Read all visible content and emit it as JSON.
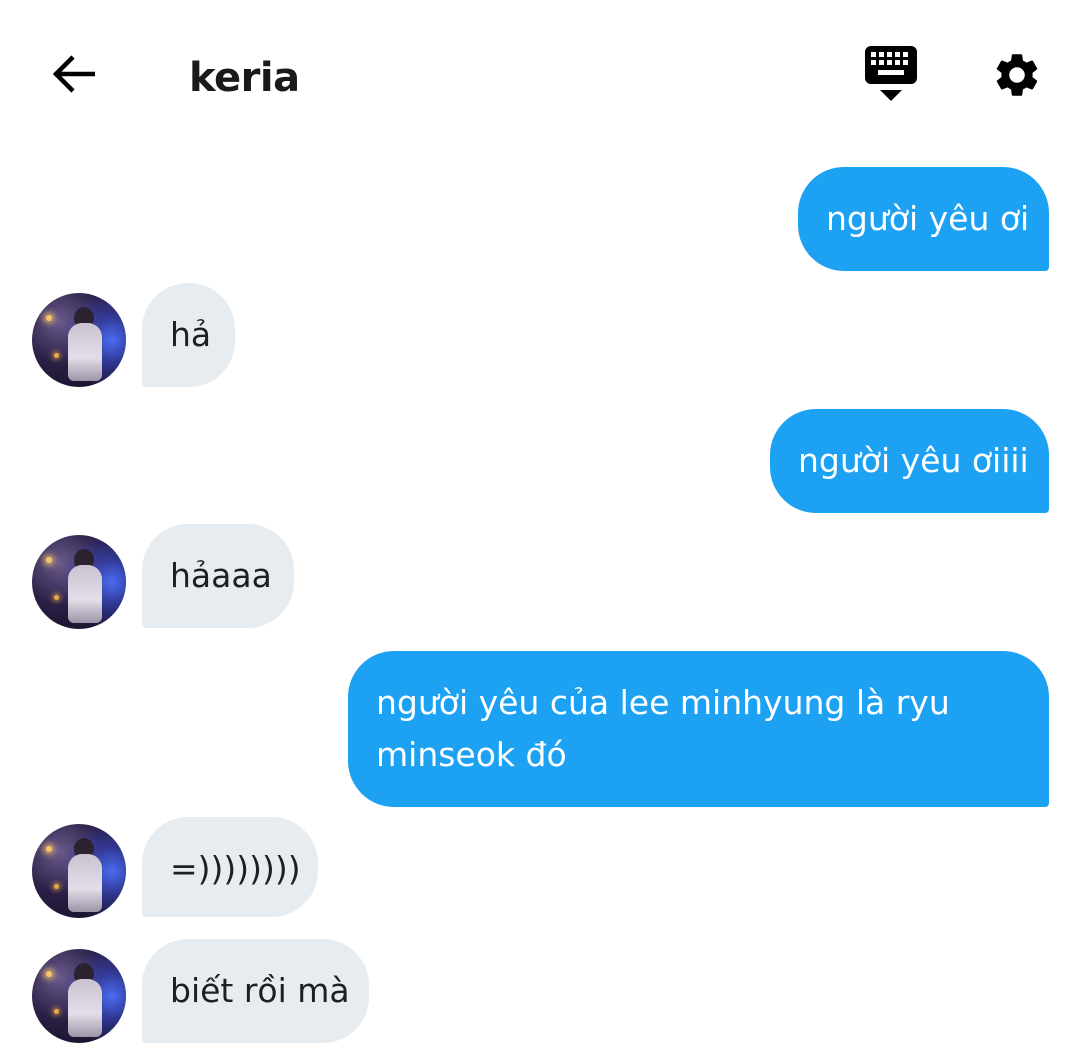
{
  "header": {
    "title": "keria",
    "back_icon": "arrow-left-icon",
    "keyboard_icon": "keyboard-hide-icon",
    "settings_icon": "gear-icon"
  },
  "colors": {
    "outgoing_bubble": "#1da1f2",
    "incoming_bubble": "#e6ecf0",
    "icon": "#000000"
  },
  "messages": [
    {
      "side": "out",
      "text": "người yêu ơi"
    },
    {
      "side": "in",
      "text": "hả"
    },
    {
      "side": "out",
      "text": "người yêu ơiiii"
    },
    {
      "side": "in",
      "text": "hảaaa"
    },
    {
      "side": "out",
      "text": "người yêu của lee minhyung là ryu",
      "text_line2": "minseok đó"
    },
    {
      "side": "in",
      "text": "=))))))))"
    },
    {
      "side": "in",
      "text": "biết rồi mà"
    }
  ]
}
